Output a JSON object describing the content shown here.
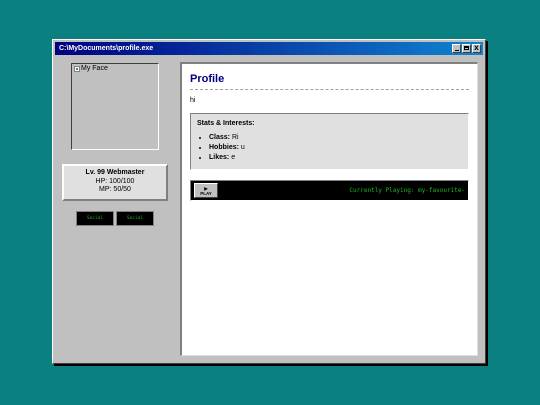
{
  "window": {
    "title": "C:\\MyDocuments\\profile.exe",
    "buttons": {
      "minimize": "_",
      "maximize": "□",
      "close": "X"
    }
  },
  "sidebar": {
    "avatar_alt": "My Face",
    "stats": {
      "level": "Lv. 99 Webmaster",
      "hp": "HP: 100/100",
      "mp": "MP: 50/50"
    },
    "buttons": [
      {
        "label": "Social"
      },
      {
        "label": "Social"
      }
    ]
  },
  "main": {
    "title": "Profile",
    "bio": "hi",
    "interests": {
      "heading": "Stats & Interests:",
      "items": [
        {
          "key": "Class:",
          "value": "Ri"
        },
        {
          "key": "Hobbies:",
          "value": "u"
        },
        {
          "key": "Likes:",
          "value": "e"
        }
      ]
    },
    "player": {
      "play_icon": "▶",
      "play_label": "PLAY",
      "now_playing": "Currently Playing: my-favourite-"
    }
  },
  "colors": {
    "desktop": "#0b8080",
    "title_bar": "#000080",
    "heading": "#000080",
    "terminal_text": "#1fb61f"
  }
}
